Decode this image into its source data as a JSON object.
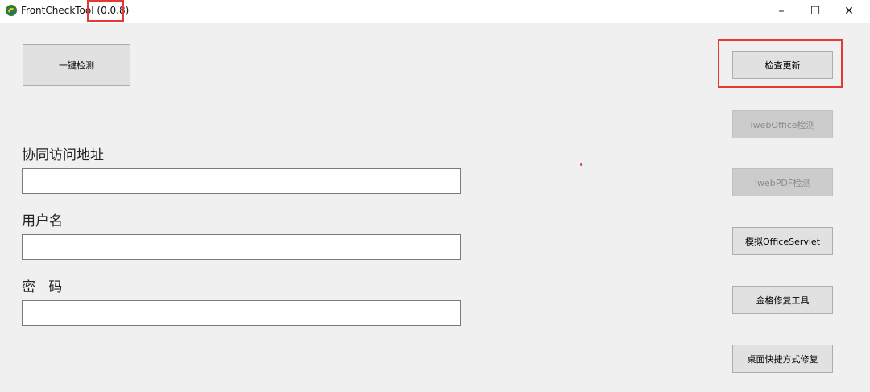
{
  "window": {
    "title": "FrontCheckTool",
    "version": "(0.0.8)",
    "minimize_label": "–",
    "maximize_label": "☐",
    "close_label": "✕"
  },
  "buttons": {
    "one_click_check": "一键检测",
    "check_update": "检查更新",
    "iweboffice_check": "IwebOffice检测",
    "iwebpdf_check": "IwebPDF检测",
    "simulate_officeservlet": "模拟OfficeServlet",
    "jinge_repair": "金格修复工具",
    "desktop_shortcut_repair": "桌面快捷方式修复"
  },
  "form": {
    "address_label": "协同访问地址",
    "address_value": "",
    "username_label": "用户名",
    "username_value": "",
    "password_label": "密   码",
    "password_value": ""
  },
  "colors": {
    "highlight": "#e53935",
    "window_bg": "#f0f0f0",
    "button_bg": "#e1e1e1"
  }
}
